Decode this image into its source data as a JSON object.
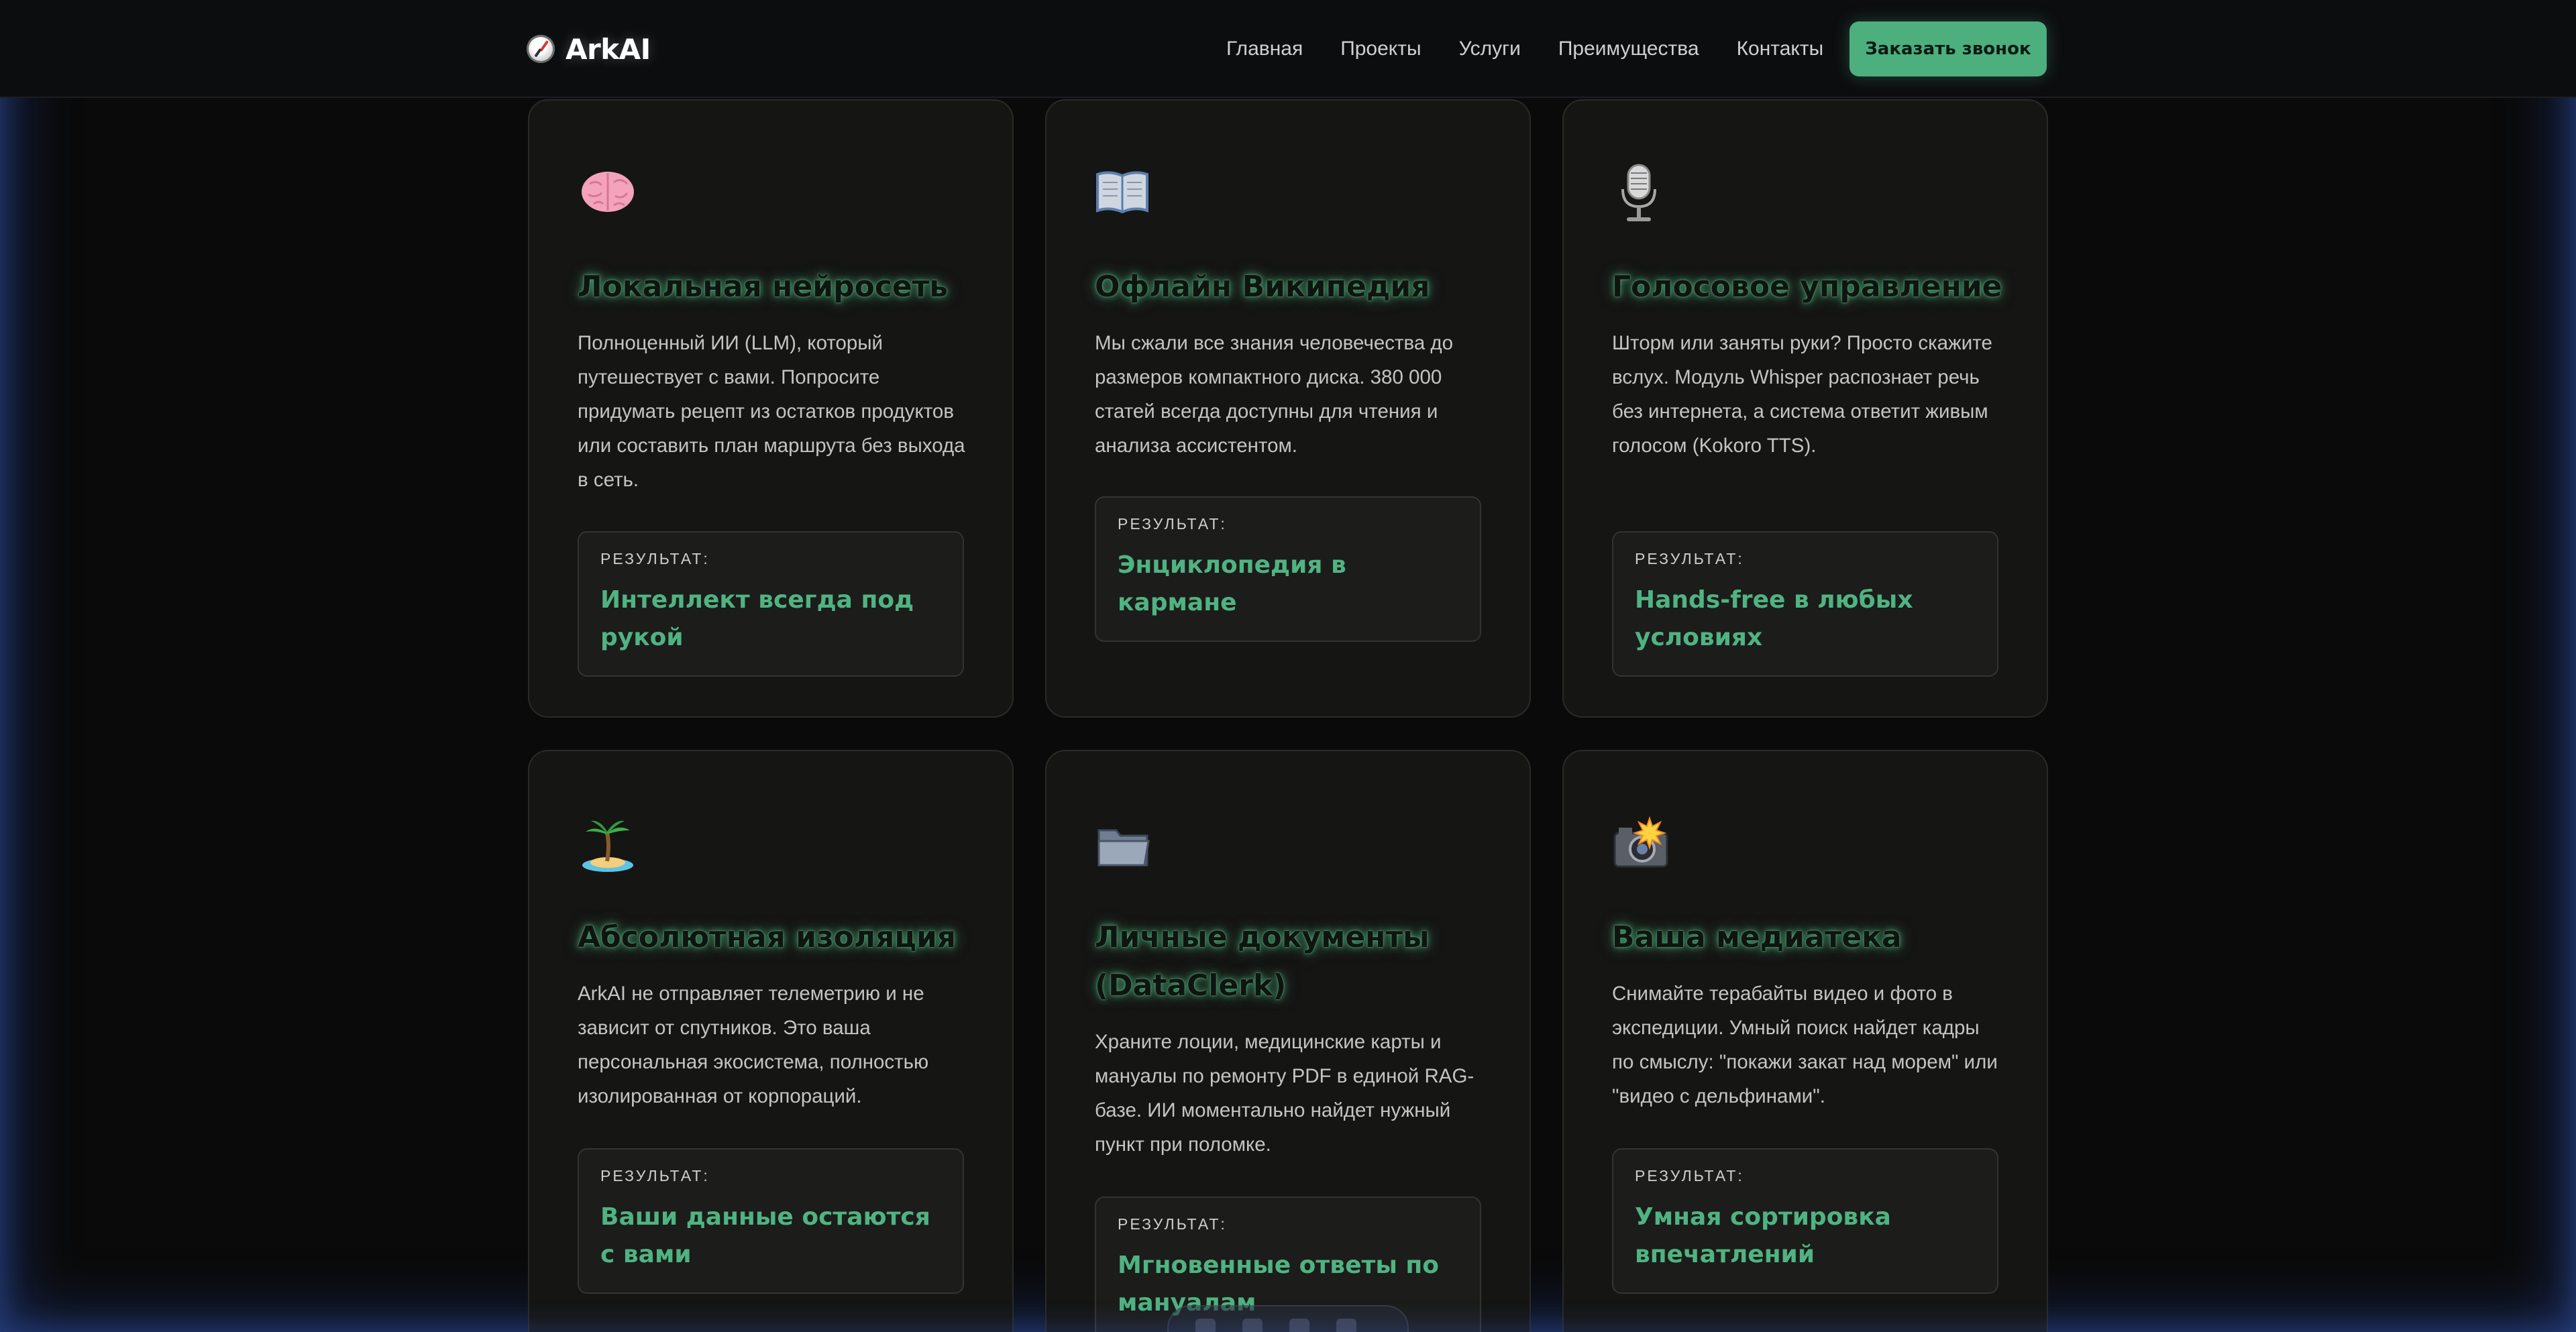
{
  "header": {
    "logo_text": "ArkAI",
    "logo_icon": "compass-icon",
    "nav": [
      "Главная",
      "Проекты",
      "Услуги",
      "Преимущества",
      "Контакты"
    ],
    "cta_label": "Заказать звонок"
  },
  "result_label": "РЕЗУЛЬТАТ:",
  "cards": [
    {
      "icon": "brain-icon",
      "title": "Локальная нейросеть",
      "description": "Полноценный ИИ (LLM), который путешествует с вами. Попросите придумать рецепт из остатков продуктов или составить план маршрута без выхода в сеть.",
      "result": "Интеллект всегда под рукой"
    },
    {
      "icon": "book-icon",
      "title": "Офлайн Википедия",
      "description": "Мы сжали все знания человечества до размеров компактного диска. 380 000 статей всегда доступны для чтения и анализа ассистентом.",
      "result": "Энциклопедия в кармане"
    },
    {
      "icon": "microphone-icon",
      "title": "Голосовое управление",
      "description": "Шторм или заняты руки? Просто скажите вслух. Модуль Whisper распознает речь без интернета, а система ответит живым голосом (Kokoro TTS).",
      "result": "Hands-free в любых условиях"
    },
    {
      "icon": "island-icon",
      "title": "Абсолютная изоляция",
      "description": "ArkAI не отправляет телеметрию и не зависит от спутников. Это ваша персональная экосистема, полностью изолированная от корпораций.",
      "result": "Ваши данные остаются с вами"
    },
    {
      "icon": "folder-icon",
      "title": "Личные документы (DataClerk)",
      "description": "Храните лоции, медицинские карты и мануалы по ремонту PDF в единой RAG-базе. ИИ моментально найдет нужный пункт при поломке.",
      "result": "Мгновенные ответы по мануалам"
    },
    {
      "icon": "camera-flash-icon",
      "title": "Ваша медиатека",
      "description": "Снимайте терабайты видео и фото в экспедиции. Умный поиск найдет кадры по смыслу: \"покажи закат над морем\" или \"видео с дельфинами\".",
      "result": "Умная сортировка впечатлений"
    }
  ]
}
